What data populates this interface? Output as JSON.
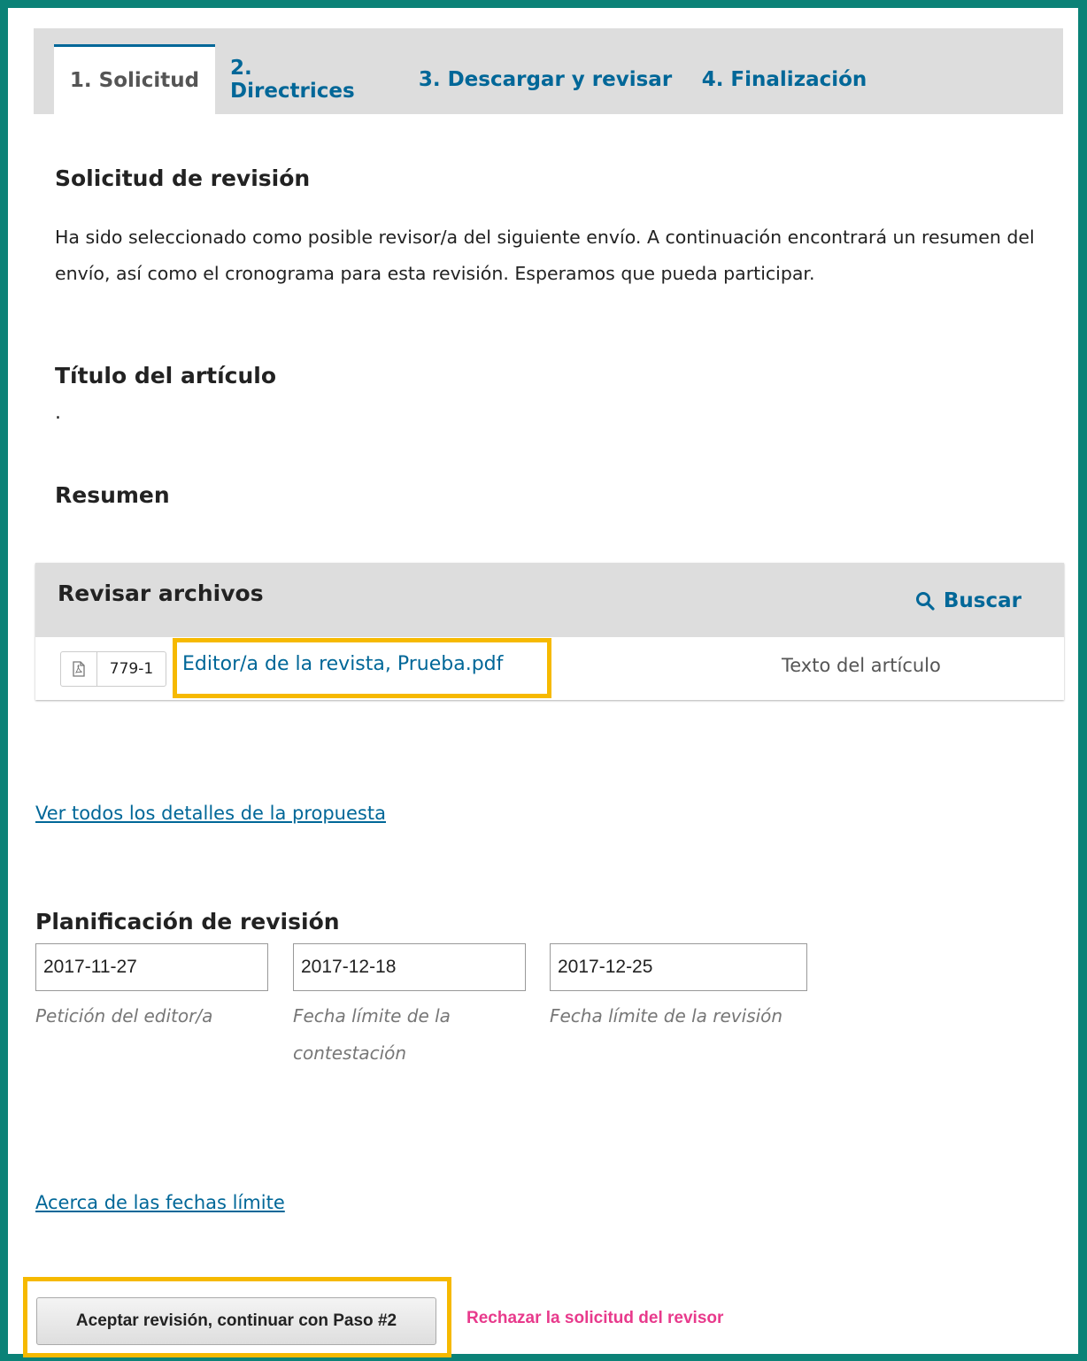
{
  "tabs": [
    {
      "label": "1. Solicitud",
      "active": true
    },
    {
      "label": "2. Directrices",
      "active": false
    },
    {
      "label": "3. Descargar y revisar",
      "active": false
    },
    {
      "label": "4. Finalización",
      "active": false
    }
  ],
  "request": {
    "heading": "Solicitud de revisión",
    "text": "Ha sido seleccionado como posible revisor/a del siguiente envío. A continuación encontrará un resumen del envío, así como el cronograma para esta revisión. Esperamos que pueda participar."
  },
  "article": {
    "title_heading": "Título del artículo",
    "title_value": ".",
    "abstract_heading": "Resumen"
  },
  "files": {
    "heading": "Revisar archivos",
    "search_label": "Buscar",
    "items": [
      {
        "id": "779-1",
        "name": "Editor/a de la revista, Prueba.pdf",
        "type": "Texto del artículo",
        "icon": "pdf-icon"
      }
    ]
  },
  "details_link": "Ver todos los detalles de la propuesta",
  "schedule": {
    "heading": "Planificación de revisión",
    "dates": [
      {
        "value": "2017-11-27",
        "label": "Petición del editor/a"
      },
      {
        "value": "2017-12-18",
        "label": "Fecha límite de la contestación"
      },
      {
        "value": "2017-12-25",
        "label": "Fecha límite de la revisión"
      }
    ]
  },
  "deadlines_link": "Acerca de las fechas límite",
  "actions": {
    "accept_label": "Aceptar revisión, continuar con Paso #2",
    "decline_label": "Rechazar la solicitud del revisor"
  },
  "colors": {
    "border": "#0b8277",
    "link": "#006798",
    "highlight": "#f6b900",
    "decline": "#e83a8c"
  }
}
